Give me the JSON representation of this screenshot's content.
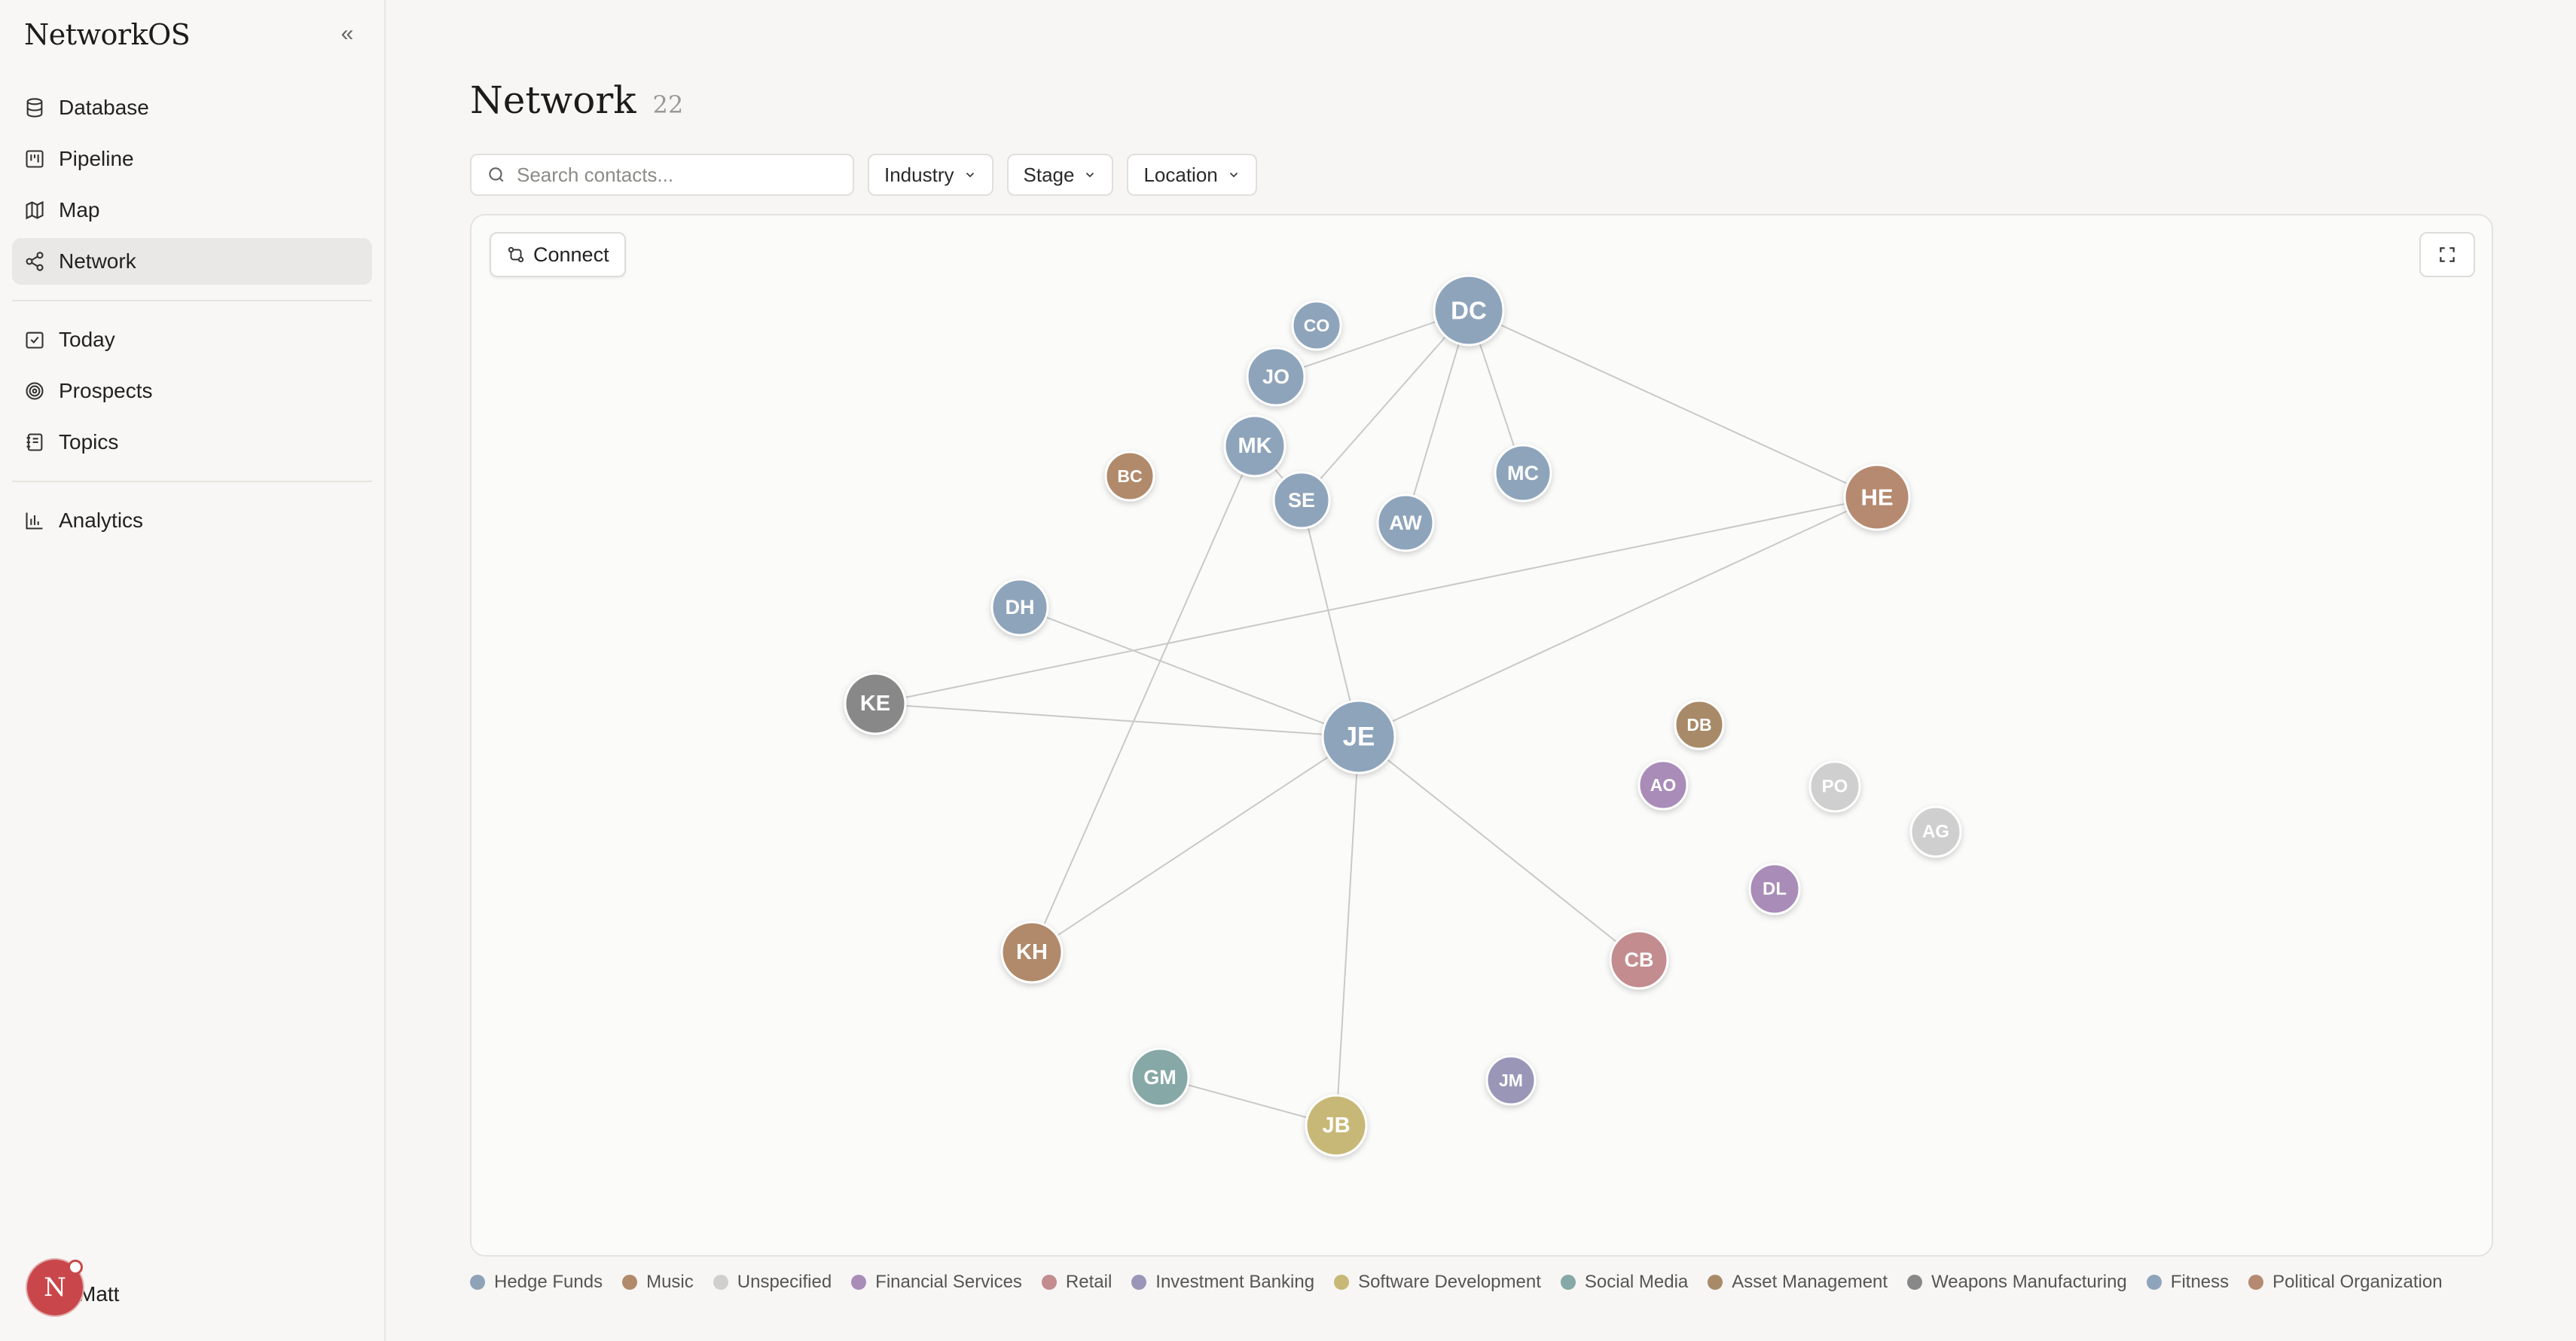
{
  "app": {
    "title": "NetworkOS",
    "collapse_icon": "chevrons-left-icon"
  },
  "sidebar": {
    "group1": [
      {
        "label": "Database",
        "icon": "database-icon"
      },
      {
        "label": "Pipeline",
        "icon": "kanban-icon"
      },
      {
        "label": "Map",
        "icon": "map-icon"
      },
      {
        "label": "Network",
        "icon": "share-icon",
        "active": true
      }
    ],
    "group2": [
      {
        "label": "Today",
        "icon": "calendar-check-icon"
      },
      {
        "label": "Prospects",
        "icon": "target-icon"
      },
      {
        "label": "Topics",
        "icon": "notebook-icon"
      }
    ],
    "group3": [
      {
        "label": "Analytics",
        "icon": "bar-chart-icon"
      }
    ],
    "user": {
      "initial": "N",
      "name": "Matt"
    }
  },
  "page": {
    "title": "Network",
    "count": "22"
  },
  "filters": {
    "search_placeholder": "Search contacts...",
    "industry": "Industry",
    "stage": "Stage",
    "location": "Location"
  },
  "toolbar": {
    "connect_label": "Connect",
    "fullscreen_icon": "maximize-icon"
  },
  "industry_colors": {
    "Hedge Funds": "#8fa3b8",
    "Music": "#b08a6a",
    "Unspecified": "#cfcfcf",
    "Financial Services": "#a98cb8",
    "Retail": "#c38c8f",
    "Investment Banking": "#9a96b8",
    "Software Development": "#c8b877",
    "Social Media": "#86a8a6",
    "Asset Management": "#a88a68",
    "Weapons Manufacturing": "#888888",
    "Fitness": "#8ea4bb",
    "Political Organization": "#b58a70"
  },
  "legend": [
    {
      "label": "Hedge Funds",
      "color": "#8fa3b8"
    },
    {
      "label": "Music",
      "color": "#b08a6a"
    },
    {
      "label": "Unspecified",
      "color": "#cfcfcf"
    },
    {
      "label": "Financial Services",
      "color": "#a98cb8"
    },
    {
      "label": "Retail",
      "color": "#c38c8f"
    },
    {
      "label": "Investment Banking",
      "color": "#9a96b8"
    },
    {
      "label": "Software Development",
      "color": "#c8b877"
    },
    {
      "label": "Social Media",
      "color": "#86a8a6"
    },
    {
      "label": "Asset Management",
      "color": "#a88a68"
    },
    {
      "label": "Weapons Manufacturing",
      "color": "#888888"
    },
    {
      "label": "Fitness",
      "color": "#8ea4bb"
    },
    {
      "label": "Political Organization",
      "color": "#b58a70"
    }
  ],
  "nodes": [
    {
      "id": "DC",
      "color": "#8ea4bb"
    },
    {
      "id": "CO",
      "color": "#8ea4bb"
    },
    {
      "id": "JO",
      "color": "#8ea4bb"
    },
    {
      "id": "MK",
      "color": "#8ea4bb"
    },
    {
      "id": "SE",
      "color": "#8ea4bb"
    },
    {
      "id": "AW",
      "color": "#8ea4bb"
    },
    {
      "id": "MC",
      "color": "#8ea4bb"
    },
    {
      "id": "BC",
      "color": "#b08a6a"
    },
    {
      "id": "HE",
      "color": "#b58a70"
    },
    {
      "id": "DH",
      "color": "#8ea4bb"
    },
    {
      "id": "KE",
      "color": "#888888"
    },
    {
      "id": "JE",
      "color": "#8ea4bb"
    },
    {
      "id": "DB",
      "color": "#a88a68"
    },
    {
      "id": "AO",
      "color": "#a98cb8"
    },
    {
      "id": "PO",
      "color": "#cfcfcf"
    },
    {
      "id": "AG",
      "color": "#cfcfcf"
    },
    {
      "id": "DL",
      "color": "#a98cb8"
    },
    {
      "id": "CB",
      "color": "#c38c8f"
    },
    {
      "id": "KH",
      "color": "#b08a6a"
    },
    {
      "id": "GM",
      "color": "#86a8a6"
    },
    {
      "id": "JB",
      "color": "#c8b877"
    },
    {
      "id": "JM",
      "color": "#9a96b8"
    }
  ],
  "edges": [
    [
      "DC",
      "JO"
    ],
    [
      "DC",
      "SE"
    ],
    [
      "DC",
      "AW"
    ],
    [
      "DC",
      "MC"
    ],
    [
      "DC",
      "HE"
    ],
    [
      "MK",
      "SE"
    ],
    [
      "MK",
      "KH"
    ],
    [
      "SE",
      "JE"
    ],
    [
      "HE",
      "KE"
    ],
    [
      "HE",
      "JE"
    ],
    [
      "DH",
      "JE"
    ],
    [
      "KE",
      "JE"
    ],
    [
      "JE",
      "KH"
    ],
    [
      "JE",
      "JB"
    ],
    [
      "JE",
      "CB"
    ],
    [
      "GM",
      "JB"
    ]
  ]
}
